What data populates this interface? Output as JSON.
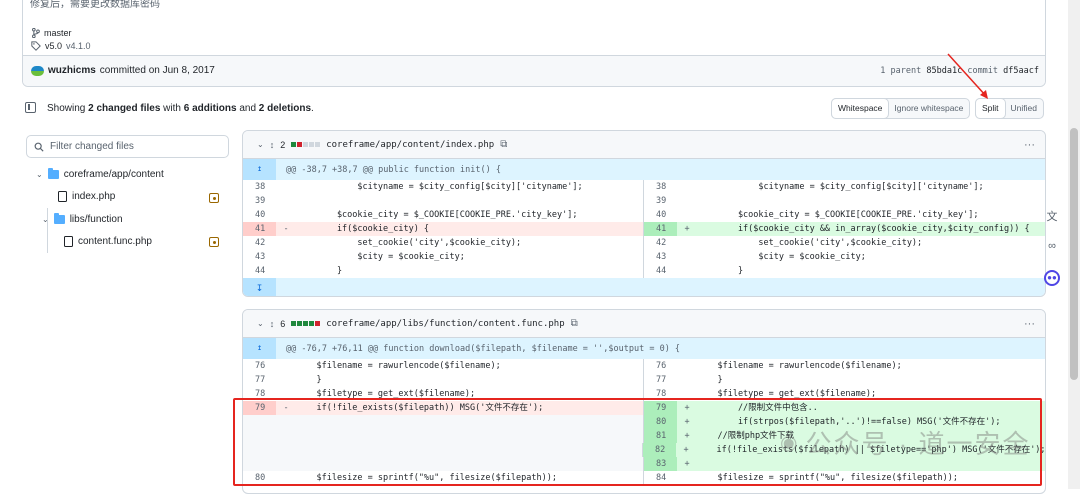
{
  "commit": {
    "message": "修复后，需要更改数据库密码",
    "branch": "master",
    "tag": "v5.0",
    "tag_version": "v4.1.0",
    "author": "wuzhicms",
    "committed_text": "committed on Jun 8, 2017",
    "parent_label": "1 parent",
    "parent_hash": "85bda1c",
    "commit_label": "commit",
    "commit_hash": "df5aacf"
  },
  "toolbar": {
    "summary_prefix": "Showing",
    "summary_files": "2 changed files",
    "summary_with": "with",
    "summary_add": "6 additions",
    "summary_and": "and",
    "summary_del": "2 deletions",
    "summary_end": ".",
    "whitespace": "Whitespace",
    "ignore_whitespace": "Ignore whitespace",
    "split": "Split",
    "unified": "Unified"
  },
  "file_tree": {
    "filter_placeholder": "Filter changed files",
    "folder1": "coreframe/app/content",
    "file1": "index.php",
    "folder2": "libs/function",
    "file2": "content.func.php"
  },
  "diff1": {
    "count": "2",
    "path": "coreframe/app/content/index.php",
    "hunk": "@@ -38,7 +38,7 @@ public function init() {",
    "rows": [
      {
        "l": "38",
        "lc": "            $cityname = $city_config[$city]['cityname'];",
        "r": "38",
        "rc": "            $cityname = $city_config[$city]['cityname'];",
        "t": "ctx"
      },
      {
        "l": "39",
        "lc": "",
        "r": "39",
        "rc": "",
        "t": "ctx"
      },
      {
        "l": "40",
        "lc": "        $cookie_city = $_COOKIE[COOKIE_PRE.'city_key'];",
        "r": "40",
        "rc": "        $cookie_city = $_COOKIE[COOKIE_PRE.'city_key'];",
        "t": "ctx"
      },
      {
        "l": "41",
        "lc": "        if($cookie_city) {",
        "r": "41",
        "rc": "        if($cookie_city && in_array($cookie_city,$city_config)) {",
        "t": "chg"
      },
      {
        "l": "42",
        "lc": "            set_cookie('city',$cookie_city);",
        "r": "42",
        "rc": "            set_cookie('city',$cookie_city);",
        "t": "ctx"
      },
      {
        "l": "43",
        "lc": "            $city = $cookie_city;",
        "r": "43",
        "rc": "            $city = $cookie_city;",
        "t": "ctx"
      },
      {
        "l": "44",
        "lc": "        }",
        "r": "44",
        "rc": "        }",
        "t": "ctx"
      }
    ]
  },
  "diff2": {
    "count": "6",
    "path": "coreframe/app/libs/function/content.func.php",
    "hunk": "@@ -76,7 +76,11 @@ function download($filepath, $filename = '',$output = 0) {",
    "rows": [
      {
        "l": "76",
        "lc": "    $filename = rawurlencode($filename);",
        "r": "76",
        "rc": "    $filename = rawurlencode($filename);",
        "t": "ctx"
      },
      {
        "l": "77",
        "lc": "    }",
        "r": "77",
        "rc": "    }",
        "t": "ctx"
      },
      {
        "l": "78",
        "lc": "    $filetype = get_ext($filename);",
        "r": "78",
        "rc": "    $filetype = get_ext($filename);",
        "t": "ctx"
      },
      {
        "l": "79",
        "lc": "    if(!file_exists($filepath)) MSG('文件不存在');",
        "r": "79",
        "rc": "        //限制文件中包含..",
        "t": "chg"
      },
      {
        "l": "",
        "lc": "",
        "r": "80",
        "rc": "        if(strpos($filepath,'..')!==false) MSG('文件不存在');",
        "t": "add"
      },
      {
        "l": "",
        "lc": "",
        "r": "81",
        "rc": "    //限制php文件下载",
        "t": "add"
      },
      {
        "l": "",
        "lc": "",
        "r": "82",
        "rc": "    if(!file_exists($filepath) || $filetype=='php') MSG('文件不存在');",
        "t": "add"
      },
      {
        "l": "",
        "lc": "",
        "r": "83",
        "rc": "",
        "t": "add"
      },
      {
        "l": "80",
        "lc": "    $filesize = sprintf(\"%u\", filesize($filepath));",
        "r": "84",
        "rc": "    $filesize = sprintf(\"%u\", filesize($filepath));",
        "t": "ctx"
      }
    ]
  },
  "watermark": "公众号 · 道一安全",
  "colors": {
    "accent": "#0969da",
    "add": "#dafbe1",
    "del": "#ffebe9",
    "annotation": "#e5251f"
  }
}
